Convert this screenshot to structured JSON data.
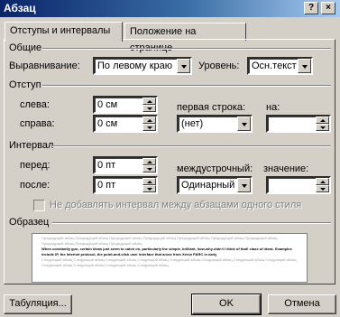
{
  "window": {
    "title": "Абзац",
    "help_btn": "?",
    "close_btn": "×"
  },
  "tabs": [
    {
      "label": "Отступы и интервалы"
    },
    {
      "label": "Положение на странице"
    }
  ],
  "general": {
    "group_title": "Общие",
    "alignment_label": "Выравнивание:",
    "alignment_value": "По левому краю",
    "level_label": "Уровень:",
    "level_value": "Осн.текст"
  },
  "indent": {
    "group_title": "Отступ",
    "left_label": "слева:",
    "left_value": "0 см",
    "right_label": "справа:",
    "right_value": "0 см",
    "first_line_label": "первая строка:",
    "first_line_value": "(нет)",
    "by_label": "на:",
    "by_value": ""
  },
  "spacing": {
    "group_title": "Интервал",
    "before_label": "перед:",
    "before_value": "0 пт",
    "after_label": "после:",
    "after_value": "0 пт",
    "line_spacing_label": "междустрочный:",
    "line_spacing_value": "Одинарный",
    "at_label": "значение:",
    "at_value": "",
    "no_space_checkbox_label": "Не добавлять интервал между абзацами одного стиля"
  },
  "preview": {
    "group_title": "Образец",
    "previous_text": "Предыдущий абзац Предыдущий абзац Предыдущий абзац Предыдущий абзац Предыдущий абзац Предыдущий абзац Предыдущий абзац Предыдущий абзац Предыдущий абзац Предыдущий абзац",
    "current_text": "When constantly gun, certain ideas just seem to catch on, particularly the simple, brilliant, how-why-didn't I think of that! class of ideas. Examples include IP, the Internet protocol, the point-and-click user interface that arose from Xerox PARC in early",
    "next_text": "Следующий абзац Следующий абзац Следующий абзац Следующий абзац Следующий абзац Следующий абзац Следующий абзац Следующий абзац Следующий абзац Следующий абзац Следующий абзац Следующий абзац"
  },
  "buttons": {
    "tabs": "Табуляция...",
    "ok": "OK",
    "cancel": "Отмена"
  }
}
